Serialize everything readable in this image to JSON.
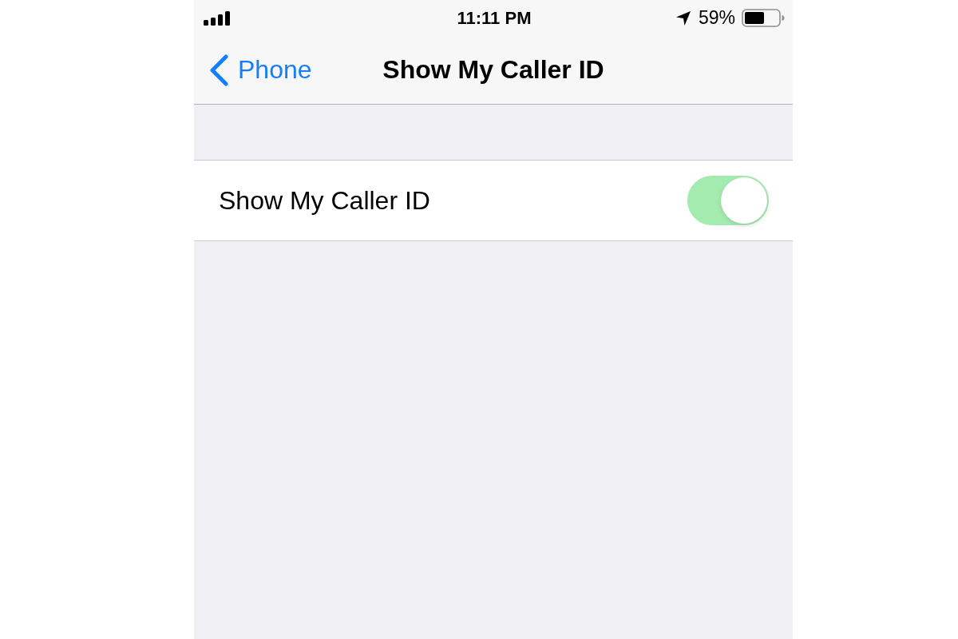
{
  "status_bar": {
    "time": "11:11 PM",
    "battery_percent": "59%"
  },
  "nav_bar": {
    "back_label": "Phone",
    "title": "Show My Caller ID"
  },
  "settings": [
    {
      "kind": "switch",
      "label": "Show My Caller ID",
      "on": true,
      "disabled": true
    }
  ]
}
